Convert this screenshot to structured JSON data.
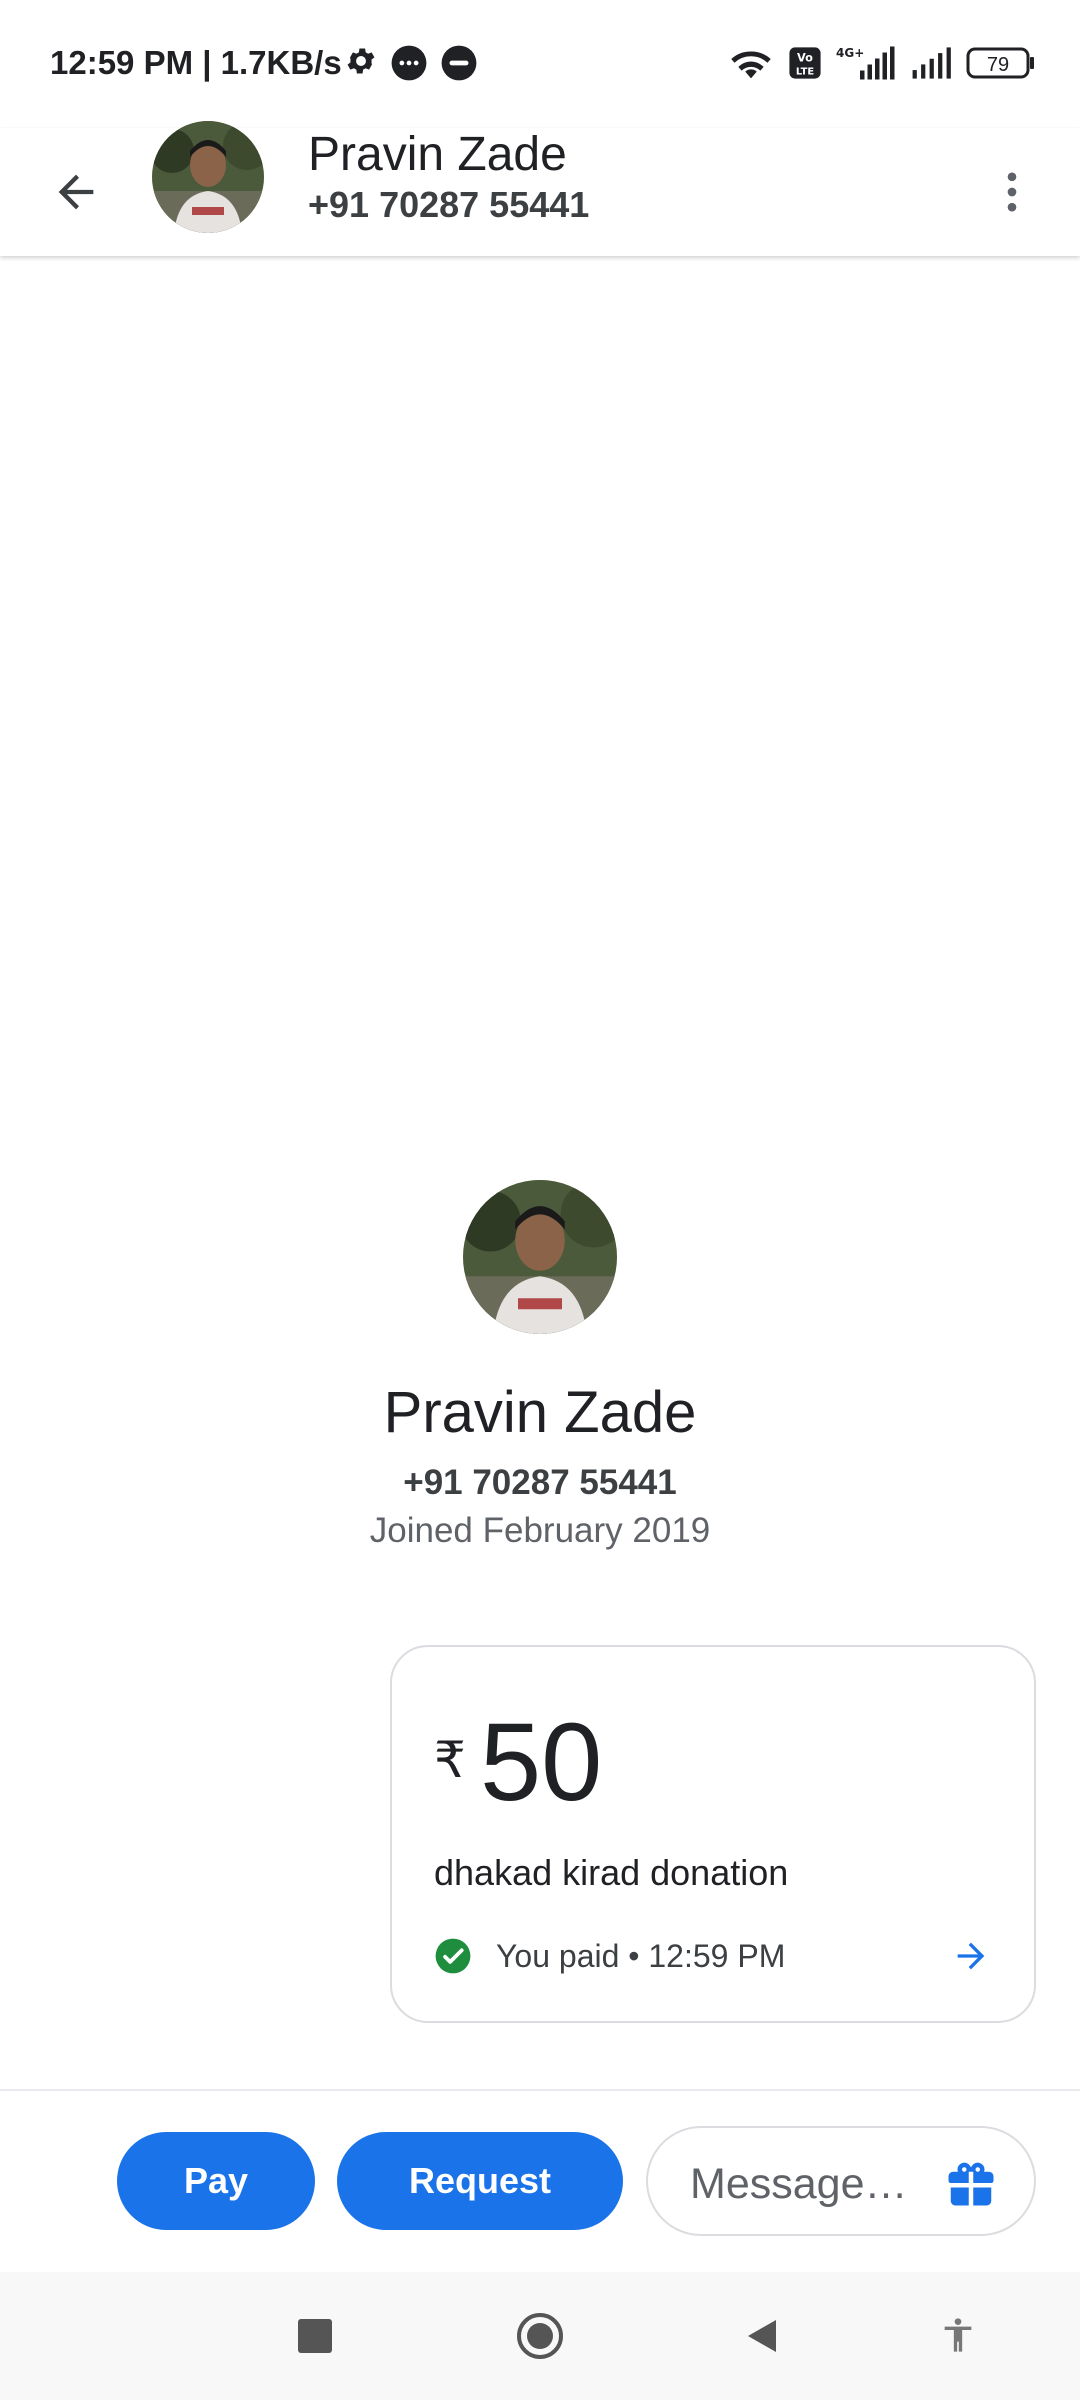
{
  "status_bar": {
    "time": "12:59 PM | 1.7KB/s",
    "network_label": "4G+",
    "volte_label": "Vo LTE",
    "battery": "79"
  },
  "header": {
    "contact_name": "Pravin Zade",
    "contact_phone": "+91 70287 55441"
  },
  "profile": {
    "name": "Pravin Zade",
    "phone": "+91 70287 55441",
    "joined": "Joined February 2019"
  },
  "payment": {
    "currency": "₹",
    "amount": "50",
    "note": "dhakad kirad donation",
    "status": "You paid • 12:59 PM",
    "status_color": "#1e8e3e"
  },
  "actions": {
    "pay_label": "Pay",
    "request_label": "Request",
    "message_placeholder": "Message…",
    "accent_color": "#1a73e8"
  }
}
